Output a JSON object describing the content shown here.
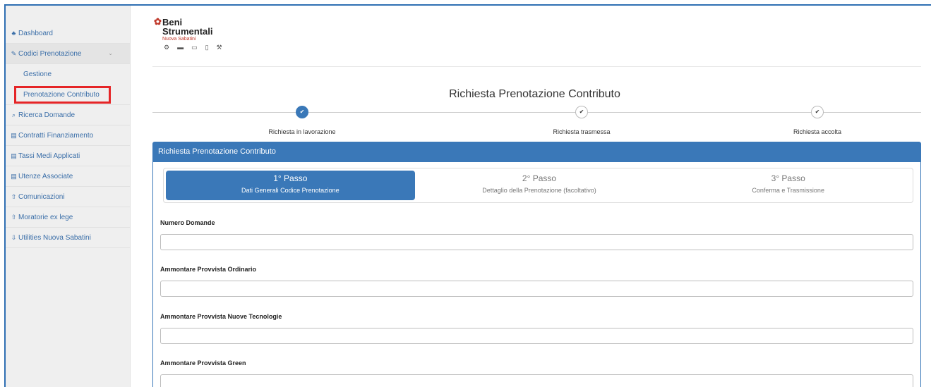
{
  "sidebar": {
    "items": [
      {
        "icon": "♣",
        "label": "Dashboard"
      },
      {
        "icon": "✎",
        "label": "Codici Prenotazione",
        "chevron": "⌄"
      },
      {
        "icon": "⌕",
        "label": "Ricerca Domande"
      },
      {
        "icon": "▤",
        "label": "Contratti Finanziamento"
      },
      {
        "icon": "▤",
        "label": "Tassi Medi Applicati"
      },
      {
        "icon": "▤",
        "label": "Utenze Associate"
      },
      {
        "icon": "⇧",
        "label": "Comunicazioni"
      },
      {
        "icon": "⇧",
        "label": "Moratorie ex lege"
      },
      {
        "icon": "⇩",
        "label": "Utilities Nuova Sabatini"
      }
    ],
    "sub_items": [
      "Gestione",
      "Prenotazione Contributo"
    ]
  },
  "logo": {
    "line1": "Beni",
    "line2": "Strumentali",
    "line3": "Nuova Sabatini",
    "tools": "⚙▬▭▯⚒"
  },
  "page_title": "Richiesta Prenotazione Contributo",
  "steps": [
    {
      "label": "Richiesta in lavorazione",
      "mark": "✔",
      "done": true
    },
    {
      "label": "Richiesta trasmessa",
      "mark": "✔",
      "done": false
    },
    {
      "label": "Richiesta accolta",
      "mark": "✔",
      "done": false
    }
  ],
  "panel_title": "Richiesta Prenotazione Contributo",
  "tabs": [
    {
      "title": "1° Passo",
      "subtitle": "Dati Generali Codice Prenotazione"
    },
    {
      "title": "2° Passo",
      "subtitle": "Dettaglio della Prenotazione (facoltativo)"
    },
    {
      "title": "3° Passo",
      "subtitle": "Conferma e Trasmissione"
    }
  ],
  "fields": [
    {
      "label": "Numero Domande",
      "value": ""
    },
    {
      "label": "Ammontare Provvista Ordinario",
      "value": ""
    },
    {
      "label": "Ammontare Provvista Nuove Tecnologie",
      "value": ""
    },
    {
      "label": "Ammontare Provvista Green",
      "value": ""
    }
  ],
  "colors": {
    "primary": "#3a78b8",
    "highlight": "#e52527",
    "brand_red": "#c0392b"
  }
}
